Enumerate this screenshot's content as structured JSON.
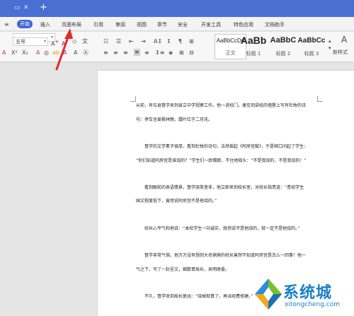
{
  "menubar": {
    "start": "开始",
    "items": [
      "插入",
      "页面布局",
      "引用",
      "审阅",
      "视图",
      "章节",
      "安全",
      "开发工具",
      "特色应用",
      "文档助手"
    ]
  },
  "ribbon": {
    "font_size": "五号",
    "styles": [
      {
        "sample": "AaBbCcDd",
        "name": "正文"
      },
      {
        "sample": "AaBb",
        "name": "标题 1"
      },
      {
        "sample": "AaBbC",
        "name": "标题 2"
      },
      {
        "sample": "AaBbCc",
        "name": "标题 3"
      }
    ],
    "new_style": "新样式"
  },
  "document": {
    "lines": [
      "从前，有位县督学来到县立中学视察工作。他一进校门，便见到梁校的墙壁上写有杜牧的诗",
      "句：停车坐爱枫林晚，霜叶红于二月花。",
      "督学的文学素子很厚，看到杜牧的诗句，洁然摇起《阿房宫赋》，于是顺口问起了学生：",
      "“你们知道阿房宫是谁烧的？”学生们一脸懵那，不住地摇头：“不是我烧的，不是我烧的！”",
      "看到眼前的表语情景，督学哭笑皆非，他立即来到校长室，对校长指责道：“贵校学生",
      "国文程度低下，竟然说阿房宫不是他烧的。”",
      "校长心平气和地说：“本校学生一向诚实，既然说不是他烧的，就一定不是他烧的。”",
      "督学非常气恼，他万万没有想到大名鼎鼎的校长竟然不知道阿房宫是怎么一回事！他一",
      "气之下，写了一封呈文，细数胃局长，哀明原委。",
      "不久，督学收到局长复函：“烧掉就算了，再派经费修建。”"
    ]
  },
  "watermark": {
    "text": "系统城",
    "url": "xitongcheng.com"
  },
  "colors": {
    "titlebar": "#4a6fd3",
    "start_button": "#3f67d1",
    "arrow": "#e02a2a",
    "watermark": "#1a7ec9"
  }
}
